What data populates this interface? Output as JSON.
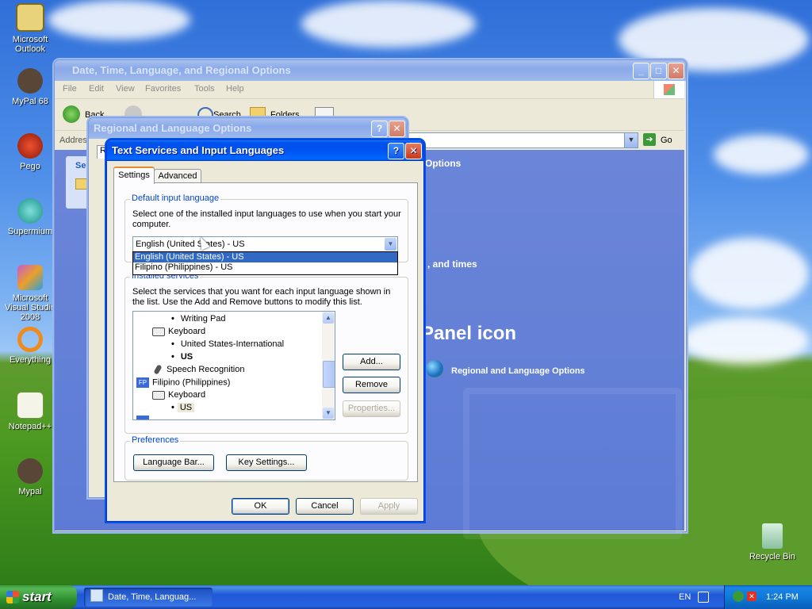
{
  "desktop": {
    "icons": [
      {
        "label": "Microsoft Outlook",
        "icon": "outlook-icon"
      },
      {
        "label": "MyPal 68",
        "icon": "mypal-icon"
      },
      {
        "label": "Pego",
        "icon": "pego-icon"
      },
      {
        "label": "Supermium",
        "icon": "supermium-icon"
      },
      {
        "label": "Microsoft Visual Studio 2008",
        "icon": "visual-studio-icon"
      },
      {
        "label": "Everything",
        "icon": "everything-icon"
      },
      {
        "label": "Notepad++",
        "icon": "notepadpp-icon"
      },
      {
        "label": "Mypal",
        "icon": "mypal-icon"
      },
      {
        "label": "Recycle Bin",
        "icon": "recycle-bin-icon"
      }
    ]
  },
  "control_panel": {
    "title": "Date, Time, Language, and Regional Options",
    "menu": [
      "File",
      "Edit",
      "View",
      "Favorites",
      "Tools",
      "Help"
    ],
    "toolbar": {
      "back": "Back",
      "search": "Search",
      "folders": "Folders"
    },
    "address_label": "Address",
    "go_label": "Go",
    "heading_fragment": "Options",
    "task_fragment": ", and times",
    "panel_icon_heading": "Panel icon",
    "panel_link": "Regional and Language Options",
    "sidebar_fragment": "Se"
  },
  "regional_dialog": {
    "title": "Regional and Language Options",
    "tab_fragment": "R"
  },
  "text_services": {
    "title": "Text Services and Input Languages",
    "tabs": [
      "Settings",
      "Advanced"
    ],
    "default_input": {
      "legend": "Default input language",
      "description": "Select one of the installed input languages to use when you start your computer.",
      "selected": "English (United States) - US",
      "options": [
        "English (United States) - US",
        "Filipino (Philippines) - US"
      ]
    },
    "installed": {
      "legend": "Installed services",
      "description": "Select the services that you want for each input language shown in the list. Use the Add and Remove buttons to modify this list.",
      "tree": [
        {
          "text": "Writing Pad",
          "kind": "bullet",
          "indent": 3
        },
        {
          "text": "Keyboard",
          "kind": "keyboard",
          "indent": 2
        },
        {
          "text": "United States-International",
          "kind": "bullet",
          "indent": 3
        },
        {
          "text": "US",
          "kind": "bullet-bold",
          "indent": 3
        },
        {
          "text": "Speech Recognition",
          "kind": "mic",
          "indent": 2
        },
        {
          "text": "Filipino (Philippines)",
          "kind": "lang-fp",
          "indent": 1
        },
        {
          "text": "Keyboard",
          "kind": "keyboard",
          "indent": 2
        },
        {
          "text": "US",
          "kind": "bullet-selected",
          "indent": 3
        }
      ],
      "add": "Add...",
      "remove": "Remove",
      "properties": "Properties..."
    },
    "preferences": {
      "legend": "Preferences",
      "language_bar": "Language Bar...",
      "key_settings": "Key Settings..."
    },
    "ok": "OK",
    "cancel": "Cancel",
    "apply": "Apply"
  },
  "taskbar": {
    "start": "start",
    "task_button": "Date, Time, Languag...",
    "lang_indicator": "EN",
    "clock": "1:24 PM"
  }
}
